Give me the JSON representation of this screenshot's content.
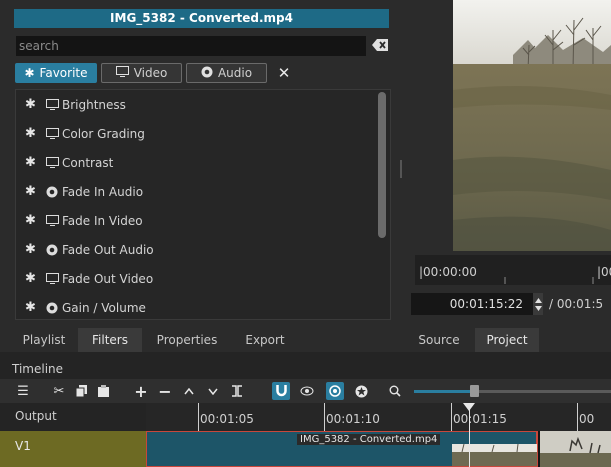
{
  "filters": {
    "title": "IMG_5382 - Converted.mp4",
    "search_placeholder": "search",
    "tabs": {
      "favorite": "Favorite",
      "video": "Video",
      "audio": "Audio"
    },
    "items": [
      {
        "label": "Brightness",
        "kind": "video"
      },
      {
        "label": "Color Grading",
        "kind": "video"
      },
      {
        "label": "Contrast",
        "kind": "video"
      },
      {
        "label": "Fade In Audio",
        "kind": "audio"
      },
      {
        "label": "Fade In Video",
        "kind": "video"
      },
      {
        "label": "Fade Out Audio",
        "kind": "audio"
      },
      {
        "label": "Fade Out Video",
        "kind": "video"
      },
      {
        "label": "Gain / Volume",
        "kind": "audio"
      }
    ]
  },
  "panel_tabs": {
    "playlist": "Playlist",
    "filters": "Filters",
    "properties": "Properties",
    "export": "Export"
  },
  "player": {
    "ruler_start": "|00:00:00",
    "ruler_end": "|00",
    "timecode": "00:01:15:22",
    "duration": "/ 00:01:5",
    "source_tab": "Source",
    "project_tab": "Project"
  },
  "timeline": {
    "title": "Timeline",
    "output_label": "Output",
    "ticks": [
      "00:01:05",
      "00:01:10",
      "00:01:15",
      "00"
    ],
    "track_label": "V1",
    "clip_label": "IMG_5382 - Converted.mp4",
    "zoom_level": 0.3
  },
  "colors": {
    "accent": "#2a7ea0",
    "title_bar": "#1e6a86",
    "track_header": "#6d6a23",
    "clip": "#1d5568",
    "clip_border": "#c8473b"
  }
}
